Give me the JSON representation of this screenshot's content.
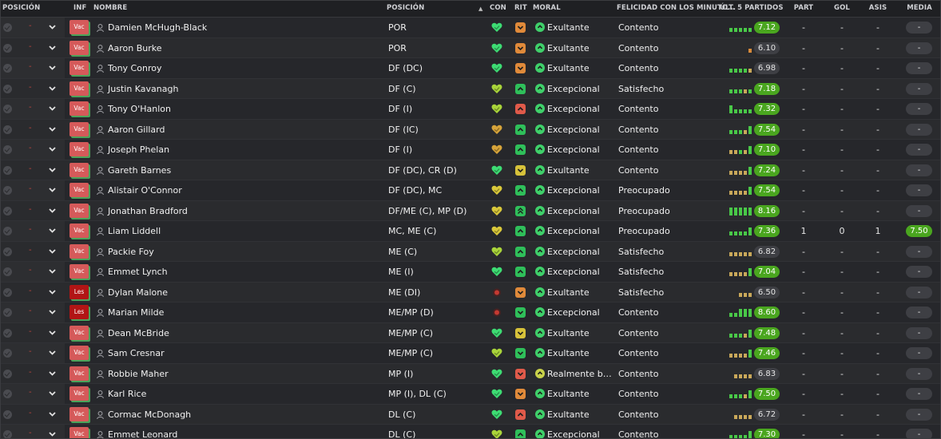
{
  "columns": {
    "posicion_sel": "POSICIÓN",
    "inf": "INF",
    "nombre": "NOMBRE",
    "posicion": "POSICIÓN",
    "sort_indicator": "▲",
    "con": "CON",
    "rit": "RIT",
    "moral": "MORAL",
    "felicidad": "FELICIDAD CON LOS MINUTO...",
    "ultimos": "ÚLT. 5 PARTIDOS",
    "part": "PART",
    "gol": "GOL",
    "asis": "ASIS",
    "media": "MEDIA"
  },
  "rows": [
    {
      "dash": "-",
      "inf": "Vac",
      "name": "Damien McHugh-Black",
      "pos": "POR",
      "con": "green",
      "rit": "orange-down",
      "moral": "Exultante",
      "moral_icon": "green",
      "fel": "Contento",
      "bars": "ggggg",
      "rating": "7.12",
      "rating_color": "green",
      "part": "-",
      "gol": "-",
      "asis": "-",
      "media": "-",
      "media_color": "grey"
    },
    {
      "dash": "-",
      "inf": "Vac",
      "name": "Aaron Burke",
      "pos": "POR",
      "con": "green",
      "rit": "orange-down",
      "moral": "Exultante",
      "moral_icon": "green",
      "fel": "Contento",
      "bars": "o",
      "rating": "6.10",
      "rating_color": "grey",
      "part": "-",
      "gol": "-",
      "asis": "-",
      "media": "-",
      "media_color": "grey"
    },
    {
      "dash": "-",
      "inf": "Vac",
      "name": "Tony Conroy",
      "pos": "DF (DC)",
      "con": "green",
      "rit": "orange-down",
      "moral": "Exultante",
      "moral_icon": "green",
      "fel": "Contento",
      "bars": "ggggy",
      "rating": "6.98",
      "rating_color": "grey",
      "part": "-",
      "gol": "-",
      "asis": "-",
      "media": "-",
      "media_color": "grey"
    },
    {
      "dash": "-",
      "inf": "Vac",
      "name": "Justin Kavanagh",
      "pos": "DF (C)",
      "con": "yellowgreen",
      "rit": "green-up",
      "moral": "Excepcional",
      "moral_icon": "green",
      "fel": "Satisfecho",
      "bars": "gggyg",
      "rating": "7.18",
      "rating_color": "green",
      "part": "-",
      "gol": "-",
      "asis": "-",
      "media": "-",
      "media_color": "grey"
    },
    {
      "dash": "-",
      "inf": "Vac",
      "name": "Tony O'Hanlon",
      "pos": "DF (I)",
      "con": "yellowgreen",
      "rit": "red-up",
      "moral": "Excepcional",
      "moral_icon": "green",
      "fel": "Contento",
      "bars": "Ggggg",
      "rating": "7.32",
      "rating_color": "green",
      "part": "-",
      "gol": "-",
      "asis": "-",
      "media": "-",
      "media_color": "grey"
    },
    {
      "dash": "-",
      "inf": "Vac",
      "name": "Aaron Gillard",
      "pos": "DF (IC)",
      "con": "gold",
      "rit": "green-up",
      "moral": "Excepcional",
      "moral_icon": "green",
      "fel": "Contento",
      "bars": "gggyG",
      "rating": "7.54",
      "rating_color": "green",
      "part": "-",
      "gol": "-",
      "asis": "-",
      "media": "-",
      "media_color": "grey"
    },
    {
      "dash": "-",
      "inf": "Vac",
      "name": "Joseph Phelan",
      "pos": "DF (I)",
      "con": "gold",
      "rit": "green-up",
      "moral": "Excepcional",
      "moral_icon": "green",
      "fel": "Contento",
      "bars": "yygyG",
      "rating": "7.10",
      "rating_color": "green",
      "part": "-",
      "gol": "-",
      "asis": "-",
      "media": "-",
      "media_color": "grey"
    },
    {
      "dash": "-",
      "inf": "Vac",
      "name": "Gareth Barnes",
      "pos": "DF (DC), CR (D)",
      "con": "green",
      "rit": "yellow-down",
      "moral": "Exultante",
      "moral_icon": "green",
      "fel": "Contento",
      "bars": "yyyyG",
      "rating": "7.24",
      "rating_color": "green",
      "part": "-",
      "gol": "-",
      "asis": "-",
      "media": "-",
      "media_color": "grey"
    },
    {
      "dash": "-",
      "inf": "Vac",
      "name": "Alistair O'Connor",
      "pos": "DF (DC), MC",
      "con": "yellow",
      "rit": "green-up",
      "moral": "Excepcional",
      "moral_icon": "green",
      "fel": "Preocupado",
      "bars": "yyyyG",
      "rating": "7.54",
      "rating_color": "green",
      "part": "-",
      "gol": "-",
      "asis": "-",
      "media": "-",
      "media_color": "grey"
    },
    {
      "dash": "-",
      "inf": "Vac",
      "name": "Jonathan Bradford",
      "pos": "DF/ME (C), MP (D)",
      "con": "yellow",
      "rit": "green-upup",
      "moral": "Excepcional",
      "moral_icon": "green",
      "fel": "Preocupado",
      "bars": "GGGGG",
      "rating": "8.16",
      "rating_color": "green",
      "part": "-",
      "gol": "-",
      "asis": "-",
      "media": "-",
      "media_color": "grey"
    },
    {
      "dash": "-",
      "inf": "Vac",
      "name": "Liam Liddell",
      "pos": "MC, ME (C)",
      "con": "yellow",
      "rit": "green-up",
      "moral": "Excepcional",
      "moral_icon": "green",
      "fel": "Preocupado",
      "bars": "ggggG",
      "rating": "7.36",
      "rating_color": "green",
      "part": "1",
      "gol": "0",
      "asis": "1",
      "media": "7.50",
      "media_color": "green"
    },
    {
      "dash": "-",
      "inf": "Vac",
      "name": "Packie Foy",
      "pos": "ME (C)",
      "con": "yellowgreen",
      "rit": "green-up",
      "moral": "Excepcional",
      "moral_icon": "green",
      "fel": "Satisfecho",
      "bars": "yyyyy",
      "rating": "6.82",
      "rating_color": "grey",
      "part": "-",
      "gol": "-",
      "asis": "-",
      "media": "-",
      "media_color": "grey"
    },
    {
      "dash": "-",
      "inf": "Vac",
      "name": "Emmet Lynch",
      "pos": "ME (I)",
      "con": "green",
      "rit": "green-up",
      "moral": "Excepcional",
      "moral_icon": "green",
      "fel": "Satisfecho",
      "bars": "yyyyG",
      "rating": "7.04",
      "rating_color": "green",
      "part": "-",
      "gol": "-",
      "asis": "-",
      "media": "-",
      "media_color": "grey"
    },
    {
      "dash": "-",
      "inf": "Les",
      "name": "Dylan Malone",
      "pos": "ME (DI)",
      "con": "red",
      "rit": "orange-down",
      "moral": "Exultante",
      "moral_icon": "green",
      "fel": "Satisfecho",
      "bars": "yyy",
      "rating": "6.50",
      "rating_color": "grey",
      "part": "-",
      "gol": "-",
      "asis": "-",
      "media": "-",
      "media_color": "grey"
    },
    {
      "dash": "-",
      "inf": "Les",
      "name": "Marian Milde",
      "pos": "ME/MP (D)",
      "con": "red",
      "rit": "green-down",
      "moral": "Excepcional",
      "moral_icon": "green",
      "fel": "Contento",
      "bars": "ggGGG",
      "rating": "8.60",
      "rating_color": "green",
      "part": "-",
      "gol": "-",
      "asis": "-",
      "media": "-",
      "media_color": "grey"
    },
    {
      "dash": "-",
      "inf": "Vac",
      "name": "Dean McBride",
      "pos": "ME/MP (C)",
      "con": "green",
      "rit": "yellow-down",
      "moral": "Exultante",
      "moral_icon": "green",
      "fel": "Contento",
      "bars": "gggyG",
      "rating": "7.48",
      "rating_color": "green",
      "part": "-",
      "gol": "-",
      "asis": "-",
      "media": "-",
      "media_color": "grey"
    },
    {
      "dash": "-",
      "inf": "Vac",
      "name": "Sam Cresnar",
      "pos": "ME/MP (C)",
      "con": "yellowgreen",
      "rit": "green-down",
      "moral": "Exultante",
      "moral_icon": "green",
      "fel": "Contento",
      "bars": "yyyyG",
      "rating": "7.46",
      "rating_color": "green",
      "part": "-",
      "gol": "-",
      "asis": "-",
      "media": "-",
      "media_color": "grey"
    },
    {
      "dash": "-",
      "inf": "Vac",
      "name": "Robbie Maher",
      "pos": "MP (I)",
      "con": "green",
      "rit": "red-down",
      "moral": "Realmente bue...",
      "moral_icon": "yellow",
      "fel": "Contento",
      "bars": "yyyy",
      "rating": "6.83",
      "rating_color": "grey",
      "part": "-",
      "gol": "-",
      "asis": "-",
      "media": "-",
      "media_color": "grey"
    },
    {
      "dash": "-",
      "inf": "Vac",
      "name": "Karl Rice",
      "pos": "MP (I), DL (C)",
      "con": "green",
      "rit": "orange-down",
      "moral": "Exultante",
      "moral_icon": "green",
      "fel": "Contento",
      "bars": "gggyG",
      "rating": "7.50",
      "rating_color": "green",
      "part": "-",
      "gol": "-",
      "asis": "-",
      "media": "-",
      "media_color": "grey"
    },
    {
      "dash": "-",
      "inf": "Vac",
      "name": "Cormac McDonagh",
      "pos": "DL (C)",
      "con": "green",
      "rit": "red-up",
      "moral": "Exultante",
      "moral_icon": "green",
      "fel": "Contento",
      "bars": "yyyy",
      "rating": "6.72",
      "rating_color": "grey",
      "part": "-",
      "gol": "-",
      "asis": "-",
      "media": "-",
      "media_color": "grey"
    },
    {
      "dash": "-",
      "inf": "Vac",
      "name": "Emmet Leonard",
      "pos": "DL (C)",
      "con": "yellowgreen",
      "rit": "green-up",
      "moral": "Excepcional",
      "moral_icon": "green",
      "fel": "Contento",
      "bars": "ggggG",
      "rating": "7.30",
      "rating_color": "green",
      "part": "-",
      "gol": "-",
      "asis": "-",
      "media": "-",
      "media_color": "grey"
    }
  ],
  "colors": {
    "background": "#26272b",
    "header": "#1f2023",
    "rating_green": "#4aa61f",
    "injury_red": "#b21515",
    "vacation_red": "#d55a5a"
  }
}
